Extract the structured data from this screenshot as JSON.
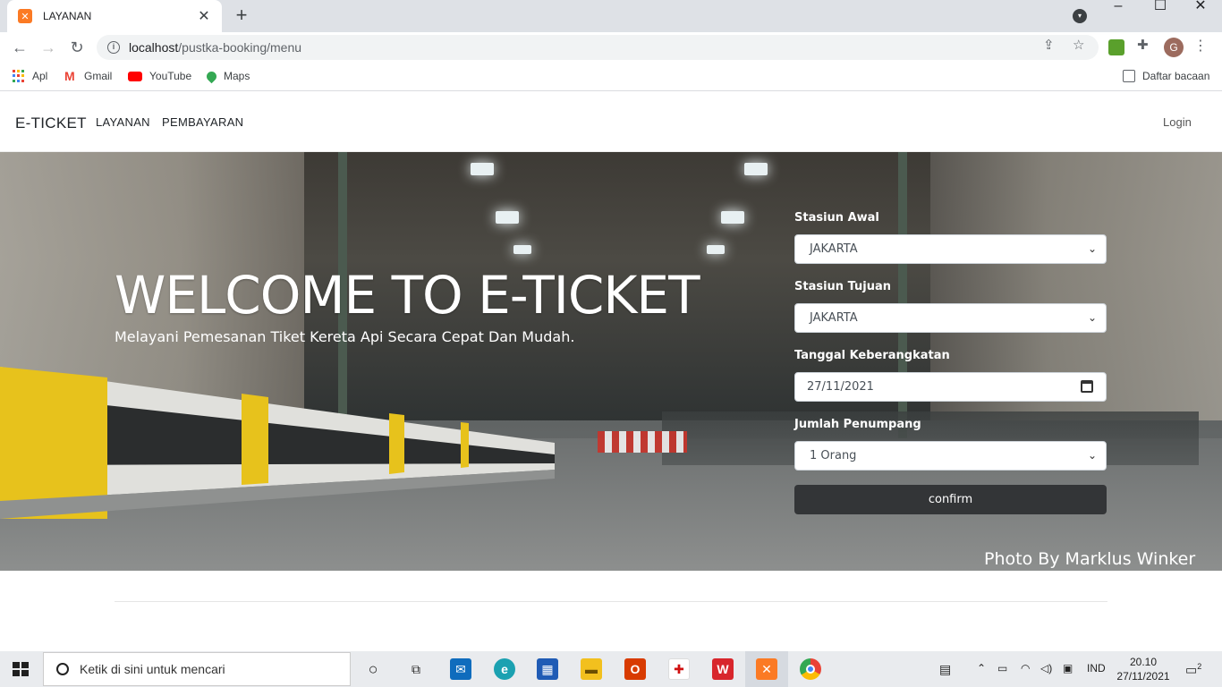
{
  "browser": {
    "tab_title": "LAYANAN",
    "url_host": "localhost",
    "url_path": "/pustka-booking/menu",
    "profile_initial": "G",
    "bookmarks": [
      "Apl",
      "Gmail",
      "YouTube",
      "Maps"
    ],
    "reading_list": "Daftar bacaan"
  },
  "site": {
    "brand": "E-TICKET",
    "nav": [
      "LAYANAN",
      "PEMBAYARAN"
    ],
    "login": "Login"
  },
  "hero": {
    "title": "WELCOME TO E-TICKET",
    "subtitle": "Melayani Pemesanan Tiket Kereta Api Secara Cepat Dan Mudah.",
    "credit": "Photo By Marklus Winker"
  },
  "form": {
    "origin_label": "Stasiun Awal",
    "origin_value": "JAKARTA",
    "destination_label": "Stasiun Tujuan",
    "destination_value": "JAKARTA",
    "date_label": "Tanggal Keberangkatan",
    "date_value": "27/11/2021",
    "passengers_label": "Jumlah Penumpang",
    "passengers_value": "1 Orang",
    "confirm_label": "confirm"
  },
  "taskbar": {
    "search_placeholder": "Ketik di sini untuk mencari",
    "language": "IND",
    "time": "20.10",
    "date": "27/11/2021",
    "notification_count": "2"
  },
  "colors": {
    "accent_dark_button": "#333537",
    "xampp_orange": "#fb7a24"
  }
}
